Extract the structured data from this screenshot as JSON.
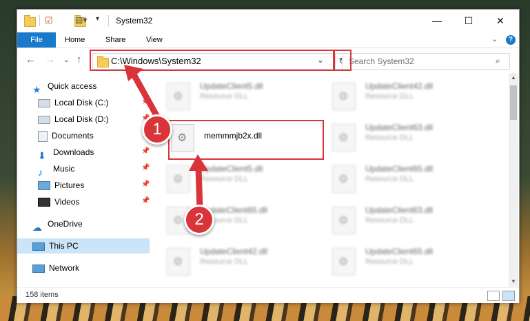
{
  "window": {
    "title": "System32"
  },
  "window_controls": {
    "minimize": "—",
    "maximize": "☐",
    "close": "✕"
  },
  "ribbon": {
    "file": "File",
    "home": "Home",
    "share": "Share",
    "view": "View",
    "help": "?"
  },
  "navbar": {
    "back": "←",
    "forward": "→",
    "recent": "⌄",
    "up": "↑",
    "address": "C:\\Windows\\System32",
    "search_placeholder": "Search System32"
  },
  "sidebar": {
    "quick_access": "Quick access",
    "items": [
      {
        "label": "Local Disk (C:)",
        "icon": "drive-icon"
      },
      {
        "label": "Local Disk (D:)",
        "icon": "drive-icon"
      },
      {
        "label": "Documents",
        "icon": "documents-icon"
      },
      {
        "label": "Downloads",
        "icon": "downloads-icon"
      },
      {
        "label": "Music",
        "icon": "music-icon"
      },
      {
        "label": "Pictures",
        "icon": "pictures-icon"
      },
      {
        "label": "Videos",
        "icon": "videos-icon"
      }
    ],
    "onedrive": "OneDrive",
    "this_pc": "This PC",
    "network": "Network"
  },
  "files": [
    {
      "name": "UpdateClient5.dll",
      "type": "Resource DLL"
    },
    {
      "name": "UpdateClient42.dll",
      "type": "Resource DLL"
    },
    {
      "name": "memmmjb2x.dll",
      "type": ""
    },
    {
      "name": "UpdateClient63.dll",
      "type": "Resource DLL"
    },
    {
      "name": "UpdateClient5.dll",
      "type": "Resource DLL"
    },
    {
      "name": "UpdateClient65.dll",
      "type": "Resource DLL"
    },
    {
      "name": "UpdateClient65.dll",
      "type": "Resource DLL"
    },
    {
      "name": "UpdateClient63.dll",
      "type": "Resource DLL"
    },
    {
      "name": "UpdateClient42.dll",
      "type": "Resource DLL"
    },
    {
      "name": "UpdateClient65.dll",
      "type": "Resource DLL"
    }
  ],
  "status": {
    "items_count": "158 items"
  },
  "callouts": {
    "one": "1",
    "two": "2"
  },
  "colors": {
    "accent": "#1979ca",
    "highlight": "#d9343a",
    "selected": "#cce4f7"
  }
}
